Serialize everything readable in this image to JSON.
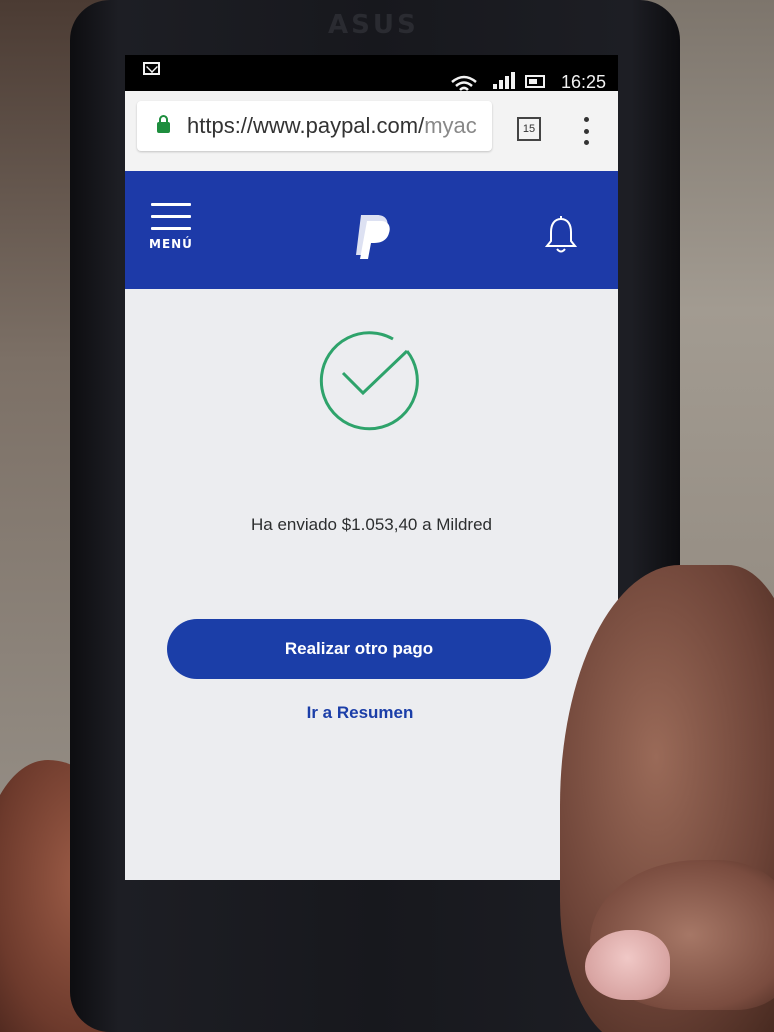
{
  "device": {
    "brand": "ASUS"
  },
  "statusbar": {
    "time": "16:25",
    "icons": [
      "mail-icon",
      "wifi-icon",
      "signal-icon",
      "battery-icon"
    ]
  },
  "browser": {
    "url_main": "https://www.paypal.com/",
    "url_dim": "myac",
    "tab_count": "15",
    "icons": [
      "lock-icon",
      "more-icon"
    ]
  },
  "header": {
    "menu_label": "MENÚ",
    "logo": "paypal-logo",
    "notification_icon": "bell-icon",
    "color": "#1d3aa8"
  },
  "confirmation": {
    "icon": "check-circle-icon",
    "icon_color": "#2ea36b",
    "message": "Ha enviado $1.053,40 a Mildred",
    "primary_button": "Realizar otro pago",
    "secondary_link": "Ir a Resumen"
  }
}
